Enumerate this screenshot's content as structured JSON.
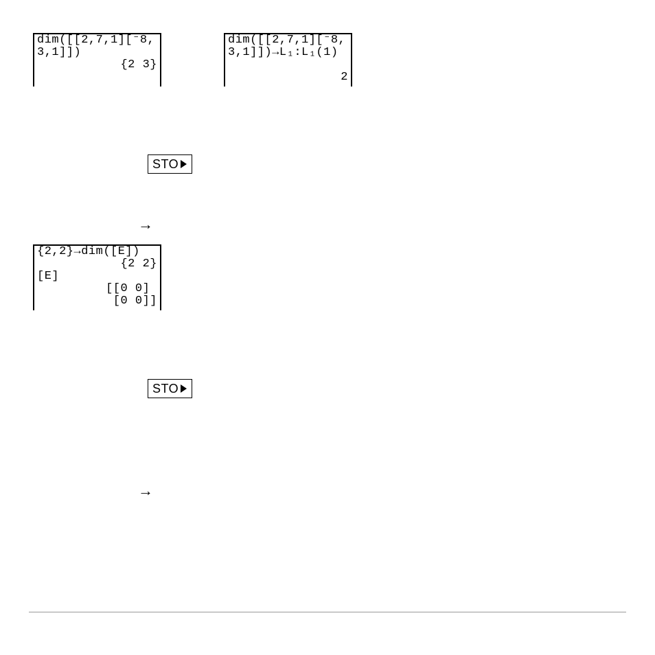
{
  "calc1": {
    "l1": "dim([[2,7,1][⁻8,",
    "l2": "3,1]])",
    "r1": "{2 3}"
  },
  "calc2": {
    "l1": "dim([[2,7,1][⁻8,",
    "l2": "3,1]])→L₁:L₁(1)",
    "r1": "2"
  },
  "calc3": {
    "l1": "{2,2}→dim([E])",
    "r1": "{2 2}",
    "l2": "[E]",
    "r2": "[[0 0] ",
    "r3": "[0 0]]"
  },
  "keycap": {
    "label": "STO"
  },
  "arrow": {
    "glyph": "→"
  }
}
